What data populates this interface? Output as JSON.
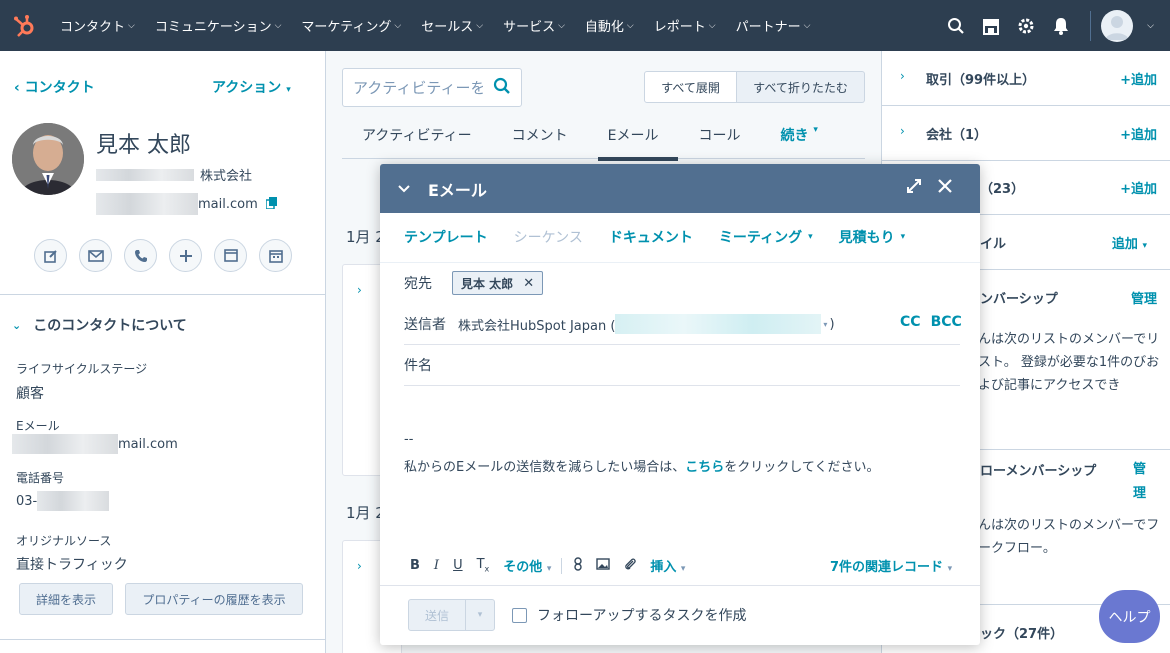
{
  "topnav": {
    "items": [
      "コンタクト",
      "コミュニケーション",
      "マーケティング",
      "セールス",
      "サービス",
      "自動化",
      "レポート",
      "パートナー"
    ],
    "icons": [
      "search-icon",
      "marketplace-icon",
      "settings-icon",
      "notifications-icon"
    ]
  },
  "left": {
    "back": "コンタクト",
    "actions": "アクション",
    "name": "見本 太郎",
    "company_suffix": "株式会社",
    "email_suffix": "mail.com",
    "about_title": "このコンタクトについて",
    "props": {
      "lifecycle_label": "ライフサイクルステージ",
      "lifecycle_value": "顧客",
      "email_label": "Eメール",
      "email_suffix": "mail.com",
      "phone_label": "電話番号",
      "phone_prefix": "03-",
      "source_label": "オリジナルソース",
      "source_value": "直接トラフィック"
    },
    "btn_details": "詳細を表示",
    "btn_history": "プロパティーの履歴を表示"
  },
  "middle": {
    "search_placeholder": "アクティビティーを検索",
    "expand_all": "すべて展開",
    "collapse_all": "すべて折りたたむ",
    "tabs": [
      "アクティビティー",
      "コメント",
      "Eメール",
      "コール",
      "続き"
    ],
    "date1": "1月 2",
    "date2": "1月 2"
  },
  "right": {
    "deals_title": "取引（99件以上）",
    "deals_add": "+追加",
    "companies_title": "会社（1）",
    "companies_add": "+追加",
    "row3_title": "（23）",
    "row3_add": "+追加",
    "row4_title": "イル",
    "row4_add": "追加",
    "member_title": "ンバーシップ",
    "member_manage": "管理",
    "member_text": "んは次のリストのメンバーでリスト。 登録が必要な1件のびおよび記事にアクセスでき",
    "flow_title": "ローメンバーシップ",
    "flow_manage": "管理",
    "flow_text": "んは次のリストのメンバーでフークフロー。",
    "row7_title": "ック（27件）",
    "help": "ヘルプ"
  },
  "email_modal": {
    "title": "Eメール",
    "toolbar": [
      "テンプレート",
      "シーケンス",
      "ドキュメント",
      "ミーティング",
      "見積もり"
    ],
    "to_label": "宛先",
    "to_chip": "見本 太郎",
    "from_label": "送信者",
    "from_value": "株式会社HubSpot Japan (",
    "from_close": ")",
    "cc": "CC",
    "bcc": "BCC",
    "subject_label": "件名",
    "signature_dash": "--",
    "unsub_pre": "私からのEメールの送信数を減らしたい場合は、",
    "unsub_link": "こちら",
    "unsub_post": "をクリックしてください。",
    "fmt_more": "その他",
    "fmt_insert": "挿入",
    "related": "7件の関連レコード",
    "send": "送信",
    "followup": "フォローアップするタスクを作成"
  },
  "colors": {
    "nav_bg": "#2d3e50",
    "accent": "#0091ae",
    "modal_header": "#516f90",
    "help": "#6a78d1",
    "logo": "#ff7a59"
  }
}
